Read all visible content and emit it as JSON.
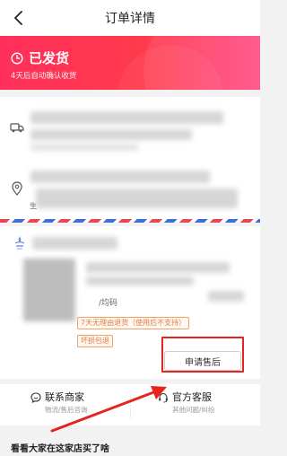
{
  "nav": {
    "title": "订单详情",
    "back_icon": "chevron-left-icon"
  },
  "status": {
    "icon": "clock-icon",
    "title": "已发货",
    "subtitle": "4天后自动确认收货",
    "color_start": "#ff2f5a",
    "color_end": "#ff4f88"
  },
  "address": {
    "truck_icon": "truck-icon",
    "pin_icon": "location-pin-icon",
    "fragment": "生"
  },
  "goods": {
    "spec_text": "/均码",
    "tags": [
      "7天无理由退货（使用后不支持）",
      "坏损包退"
    ],
    "after_sale_button": "申请售后"
  },
  "service": {
    "contact_seller": {
      "label": "联系商家",
      "sub": "物流/售后咨询",
      "icon": "chat-bubble-icon"
    },
    "official_service": {
      "label": "官方客服",
      "sub": "其他问题/纠纷",
      "icon": "headset-icon"
    }
  },
  "recommend": {
    "title": "看看大家在这家店买了啥"
  },
  "colors": {
    "accent": "#ff3a4c",
    "annotation": "#e6231d",
    "tag": "#e77b3b"
  }
}
